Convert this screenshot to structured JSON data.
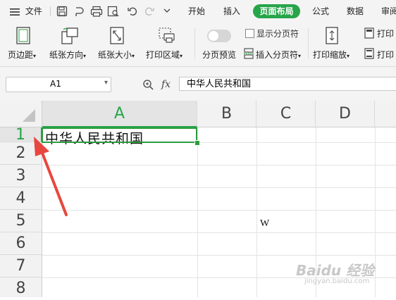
{
  "menubar": {
    "menu_icon_label": "文件",
    "tabs": [
      "开始",
      "插入",
      "页面布局",
      "公式",
      "数据",
      "审阅"
    ],
    "active_tab_index": 2
  },
  "ribbon": {
    "margins": "页边距",
    "orientation": "纸张方向",
    "size": "纸张大小",
    "print_area": "打印区域",
    "page_break_preview": "分页预览",
    "show_page_breaks": "显示分页符",
    "insert_page_break": "插入分页符",
    "print_scale": "打印缩放",
    "print_titles": "打印",
    "print_header": "打印"
  },
  "formula_bar": {
    "cell_ref": "A1",
    "fx_label": "fx",
    "value": "中华人民共和国"
  },
  "grid": {
    "columns": [
      "A",
      "B",
      "C",
      "D"
    ],
    "rows": [
      "1",
      "2",
      "3",
      "4",
      "5",
      "6",
      "7",
      "8"
    ],
    "active_row": "1",
    "active_column": "A",
    "cell_A1": "中华人民共和国",
    "cell_C5": "W"
  },
  "watermark": {
    "text": "Baidu 经验",
    "sub": "jingyan.baidu.com"
  },
  "colors": {
    "accent": "#27a54a",
    "arrow": "#e8473f"
  }
}
